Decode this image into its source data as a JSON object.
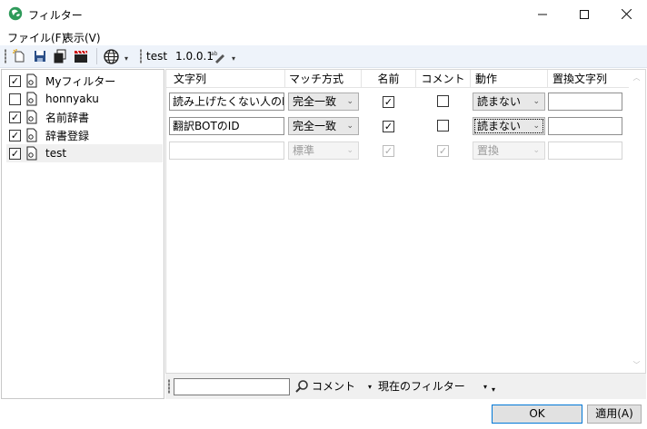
{
  "window": {
    "title": "フィルター",
    "icon": "globe-leaf-icon",
    "controls": [
      "minimize-icon",
      "maximize-icon",
      "close-icon"
    ]
  },
  "menu": {
    "items": [
      {
        "label": "ファイル(F)"
      },
      {
        "label": "表示(V)"
      }
    ]
  },
  "toolbar": {
    "icons": [
      "new-filter-icon",
      "save-icon",
      "copy-icon",
      "clapper-icon",
      "globe-icon"
    ],
    "name": "test",
    "version": "1.0.0.1",
    "edit_icon": "rename-pen-icon"
  },
  "filters": [
    {
      "label": "Myフィルター",
      "checked": true
    },
    {
      "label": "honnyaku",
      "checked": false
    },
    {
      "label": "名前辞書",
      "checked": true
    },
    {
      "label": "辞書登録",
      "checked": true
    },
    {
      "label": "test",
      "checked": true,
      "selected": true
    }
  ],
  "grid": {
    "columns": [
      "文字列",
      "マッチ方式",
      "名前",
      "コメント",
      "動作",
      "置換文字列"
    ],
    "rows": [
      {
        "text": "読み上げたくない人のID",
        "match": "完全一致",
        "name": true,
        "comment": false,
        "action": "読まない",
        "replace": ""
      },
      {
        "text": "翻訳BOTのID",
        "match": "完全一致",
        "name": true,
        "comment": false,
        "action": "読まない",
        "replace": ""
      },
      {
        "text": "",
        "match": "標準",
        "name": true,
        "comment": true,
        "action": "置換",
        "replace": "",
        "new_row": true
      }
    ]
  },
  "search": {
    "value": "",
    "field": "コメント",
    "scope": "現在のフィルター"
  },
  "buttons": {
    "ok": "OK",
    "apply": "適用(A)"
  },
  "colors": {
    "toolbar_bg": "#eef3fa",
    "ok_border": "#0078d7"
  }
}
